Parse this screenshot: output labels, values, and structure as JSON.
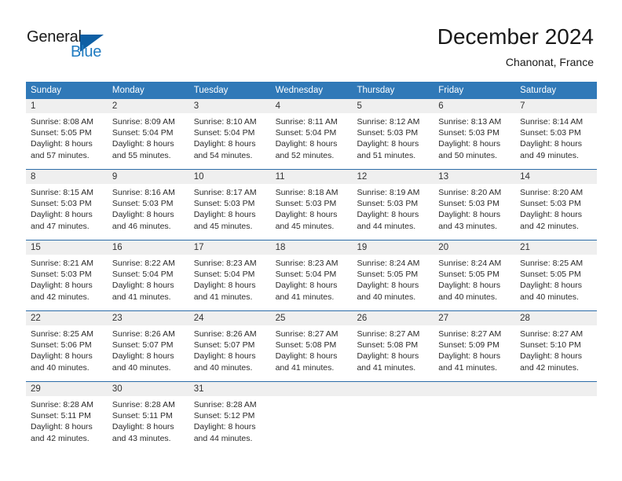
{
  "logo": {
    "word_one": "General",
    "word_two": "Blue",
    "accent_color": "#0e5fa4",
    "text_color": "#1f7bc1"
  },
  "header": {
    "title": "December 2024",
    "location": "Chanonat, France",
    "header_bg_color": "#3079b8",
    "row_divider_color": "#2c6ca8",
    "daynum_bg_color": "#efefef"
  },
  "weekday_headers": [
    "Sunday",
    "Monday",
    "Tuesday",
    "Wednesday",
    "Thursday",
    "Friday",
    "Saturday"
  ],
  "weeks": [
    {
      "days": [
        {
          "num": "1",
          "sunrise": "Sunrise: 8:08 AM",
          "sunset": "Sunset: 5:05 PM",
          "daylight_1": "Daylight: 8 hours",
          "daylight_2": "and 57 minutes."
        },
        {
          "num": "2",
          "sunrise": "Sunrise: 8:09 AM",
          "sunset": "Sunset: 5:04 PM",
          "daylight_1": "Daylight: 8 hours",
          "daylight_2": "and 55 minutes."
        },
        {
          "num": "3",
          "sunrise": "Sunrise: 8:10 AM",
          "sunset": "Sunset: 5:04 PM",
          "daylight_1": "Daylight: 8 hours",
          "daylight_2": "and 54 minutes."
        },
        {
          "num": "4",
          "sunrise": "Sunrise: 8:11 AM",
          "sunset": "Sunset: 5:04 PM",
          "daylight_1": "Daylight: 8 hours",
          "daylight_2": "and 52 minutes."
        },
        {
          "num": "5",
          "sunrise": "Sunrise: 8:12 AM",
          "sunset": "Sunset: 5:03 PM",
          "daylight_1": "Daylight: 8 hours",
          "daylight_2": "and 51 minutes."
        },
        {
          "num": "6",
          "sunrise": "Sunrise: 8:13 AM",
          "sunset": "Sunset: 5:03 PM",
          "daylight_1": "Daylight: 8 hours",
          "daylight_2": "and 50 minutes."
        },
        {
          "num": "7",
          "sunrise": "Sunrise: 8:14 AM",
          "sunset": "Sunset: 5:03 PM",
          "daylight_1": "Daylight: 8 hours",
          "daylight_2": "and 49 minutes."
        }
      ]
    },
    {
      "days": [
        {
          "num": "8",
          "sunrise": "Sunrise: 8:15 AM",
          "sunset": "Sunset: 5:03 PM",
          "daylight_1": "Daylight: 8 hours",
          "daylight_2": "and 47 minutes."
        },
        {
          "num": "9",
          "sunrise": "Sunrise: 8:16 AM",
          "sunset": "Sunset: 5:03 PM",
          "daylight_1": "Daylight: 8 hours",
          "daylight_2": "and 46 minutes."
        },
        {
          "num": "10",
          "sunrise": "Sunrise: 8:17 AM",
          "sunset": "Sunset: 5:03 PM",
          "daylight_1": "Daylight: 8 hours",
          "daylight_2": "and 45 minutes."
        },
        {
          "num": "11",
          "sunrise": "Sunrise: 8:18 AM",
          "sunset": "Sunset: 5:03 PM",
          "daylight_1": "Daylight: 8 hours",
          "daylight_2": "and 45 minutes."
        },
        {
          "num": "12",
          "sunrise": "Sunrise: 8:19 AM",
          "sunset": "Sunset: 5:03 PM",
          "daylight_1": "Daylight: 8 hours",
          "daylight_2": "and 44 minutes."
        },
        {
          "num": "13",
          "sunrise": "Sunrise: 8:20 AM",
          "sunset": "Sunset: 5:03 PM",
          "daylight_1": "Daylight: 8 hours",
          "daylight_2": "and 43 minutes."
        },
        {
          "num": "14",
          "sunrise": "Sunrise: 8:20 AM",
          "sunset": "Sunset: 5:03 PM",
          "daylight_1": "Daylight: 8 hours",
          "daylight_2": "and 42 minutes."
        }
      ]
    },
    {
      "days": [
        {
          "num": "15",
          "sunrise": "Sunrise: 8:21 AM",
          "sunset": "Sunset: 5:03 PM",
          "daylight_1": "Daylight: 8 hours",
          "daylight_2": "and 42 minutes."
        },
        {
          "num": "16",
          "sunrise": "Sunrise: 8:22 AM",
          "sunset": "Sunset: 5:04 PM",
          "daylight_1": "Daylight: 8 hours",
          "daylight_2": "and 41 minutes."
        },
        {
          "num": "17",
          "sunrise": "Sunrise: 8:23 AM",
          "sunset": "Sunset: 5:04 PM",
          "daylight_1": "Daylight: 8 hours",
          "daylight_2": "and 41 minutes."
        },
        {
          "num": "18",
          "sunrise": "Sunrise: 8:23 AM",
          "sunset": "Sunset: 5:04 PM",
          "daylight_1": "Daylight: 8 hours",
          "daylight_2": "and 41 minutes."
        },
        {
          "num": "19",
          "sunrise": "Sunrise: 8:24 AM",
          "sunset": "Sunset: 5:05 PM",
          "daylight_1": "Daylight: 8 hours",
          "daylight_2": "and 40 minutes."
        },
        {
          "num": "20",
          "sunrise": "Sunrise: 8:24 AM",
          "sunset": "Sunset: 5:05 PM",
          "daylight_1": "Daylight: 8 hours",
          "daylight_2": "and 40 minutes."
        },
        {
          "num": "21",
          "sunrise": "Sunrise: 8:25 AM",
          "sunset": "Sunset: 5:05 PM",
          "daylight_1": "Daylight: 8 hours",
          "daylight_2": "and 40 minutes."
        }
      ]
    },
    {
      "days": [
        {
          "num": "22",
          "sunrise": "Sunrise: 8:25 AM",
          "sunset": "Sunset: 5:06 PM",
          "daylight_1": "Daylight: 8 hours",
          "daylight_2": "and 40 minutes."
        },
        {
          "num": "23",
          "sunrise": "Sunrise: 8:26 AM",
          "sunset": "Sunset: 5:07 PM",
          "daylight_1": "Daylight: 8 hours",
          "daylight_2": "and 40 minutes."
        },
        {
          "num": "24",
          "sunrise": "Sunrise: 8:26 AM",
          "sunset": "Sunset: 5:07 PM",
          "daylight_1": "Daylight: 8 hours",
          "daylight_2": "and 40 minutes."
        },
        {
          "num": "25",
          "sunrise": "Sunrise: 8:27 AM",
          "sunset": "Sunset: 5:08 PM",
          "daylight_1": "Daylight: 8 hours",
          "daylight_2": "and 41 minutes."
        },
        {
          "num": "26",
          "sunrise": "Sunrise: 8:27 AM",
          "sunset": "Sunset: 5:08 PM",
          "daylight_1": "Daylight: 8 hours",
          "daylight_2": "and 41 minutes."
        },
        {
          "num": "27",
          "sunrise": "Sunrise: 8:27 AM",
          "sunset": "Sunset: 5:09 PM",
          "daylight_1": "Daylight: 8 hours",
          "daylight_2": "and 41 minutes."
        },
        {
          "num": "28",
          "sunrise": "Sunrise: 8:27 AM",
          "sunset": "Sunset: 5:10 PM",
          "daylight_1": "Daylight: 8 hours",
          "daylight_2": "and 42 minutes."
        }
      ]
    },
    {
      "days": [
        {
          "num": "29",
          "sunrise": "Sunrise: 8:28 AM",
          "sunset": "Sunset: 5:11 PM",
          "daylight_1": "Daylight: 8 hours",
          "daylight_2": "and 42 minutes."
        },
        {
          "num": "30",
          "sunrise": "Sunrise: 8:28 AM",
          "sunset": "Sunset: 5:11 PM",
          "daylight_1": "Daylight: 8 hours",
          "daylight_2": "and 43 minutes."
        },
        {
          "num": "31",
          "sunrise": "Sunrise: 8:28 AM",
          "sunset": "Sunset: 5:12 PM",
          "daylight_1": "Daylight: 8 hours",
          "daylight_2": "and 44 minutes."
        },
        {
          "num": "",
          "sunrise": "",
          "sunset": "",
          "daylight_1": "",
          "daylight_2": ""
        },
        {
          "num": "",
          "sunrise": "",
          "sunset": "",
          "daylight_1": "",
          "daylight_2": ""
        },
        {
          "num": "",
          "sunrise": "",
          "sunset": "",
          "daylight_1": "",
          "daylight_2": ""
        },
        {
          "num": "",
          "sunrise": "",
          "sunset": "",
          "daylight_1": "",
          "daylight_2": ""
        }
      ]
    }
  ]
}
